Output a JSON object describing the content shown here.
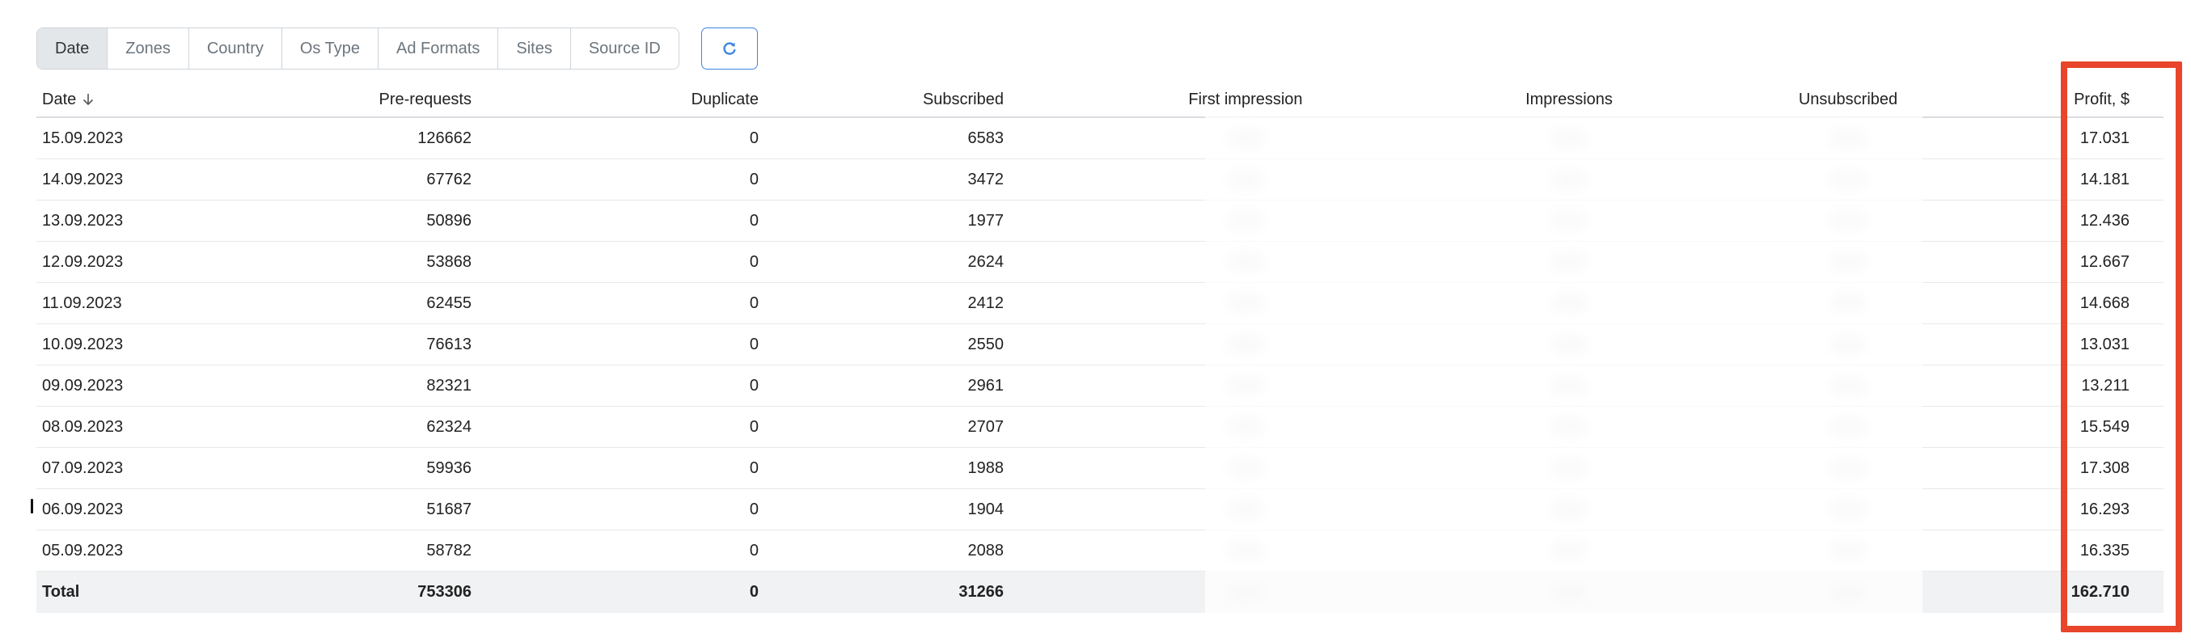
{
  "tabs": [
    {
      "label": "Date",
      "active": true
    },
    {
      "label": "Zones",
      "active": false
    },
    {
      "label": "Country",
      "active": false
    },
    {
      "label": "Os Type",
      "active": false
    },
    {
      "label": "Ad Formats",
      "active": false
    },
    {
      "label": "Sites",
      "active": false
    },
    {
      "label": "Source ID",
      "active": false
    }
  ],
  "refresh_icon": "refresh-icon",
  "columns": {
    "date": "Date",
    "pre_requests": "Pre-requests",
    "duplicate": "Duplicate",
    "subscribed": "Subscribed",
    "first_impression": "First impression",
    "impressions": "Impressions",
    "unsubscribed": "Unsubscribed",
    "profit": "Profit, $"
  },
  "sort_icon": "arrow-down-icon",
  "rows": [
    {
      "date": "15.09.2023",
      "pre_requests": "126662",
      "duplicate": "0",
      "subscribed": "6583",
      "profit": "17.031"
    },
    {
      "date": "14.09.2023",
      "pre_requests": "67762",
      "duplicate": "0",
      "subscribed": "3472",
      "profit": "14.181"
    },
    {
      "date": "13.09.2023",
      "pre_requests": "50896",
      "duplicate": "0",
      "subscribed": "1977",
      "profit": "12.436"
    },
    {
      "date": "12.09.2023",
      "pre_requests": "53868",
      "duplicate": "0",
      "subscribed": "2624",
      "profit": "12.667"
    },
    {
      "date": "11.09.2023",
      "pre_requests": "62455",
      "duplicate": "0",
      "subscribed": "2412",
      "profit": "14.668"
    },
    {
      "date": "10.09.2023",
      "pre_requests": "76613",
      "duplicate": "0",
      "subscribed": "2550",
      "profit": "13.031"
    },
    {
      "date": "09.09.2023",
      "pre_requests": "82321",
      "duplicate": "0",
      "subscribed": "2961",
      "profit": "13.211"
    },
    {
      "date": "08.09.2023",
      "pre_requests": "62324",
      "duplicate": "0",
      "subscribed": "2707",
      "profit": "15.549"
    },
    {
      "date": "07.09.2023",
      "pre_requests": "59936",
      "duplicate": "0",
      "subscribed": "1988",
      "profit": "17.308"
    },
    {
      "date": "06.09.2023",
      "pre_requests": "51687",
      "duplicate": "0",
      "subscribed": "1904",
      "profit": "16.293"
    },
    {
      "date": "05.09.2023",
      "pre_requests": "58782",
      "duplicate": "0",
      "subscribed": "2088",
      "profit": "16.335"
    }
  ],
  "total": {
    "label": "Total",
    "pre_requests": "753306",
    "duplicate": "0",
    "subscribed": "31266",
    "profit": "162.710"
  },
  "colors": {
    "highlight": "#e8452b",
    "accent": "#3f86e0",
    "active_tab_bg": "#e4e7ea"
  }
}
